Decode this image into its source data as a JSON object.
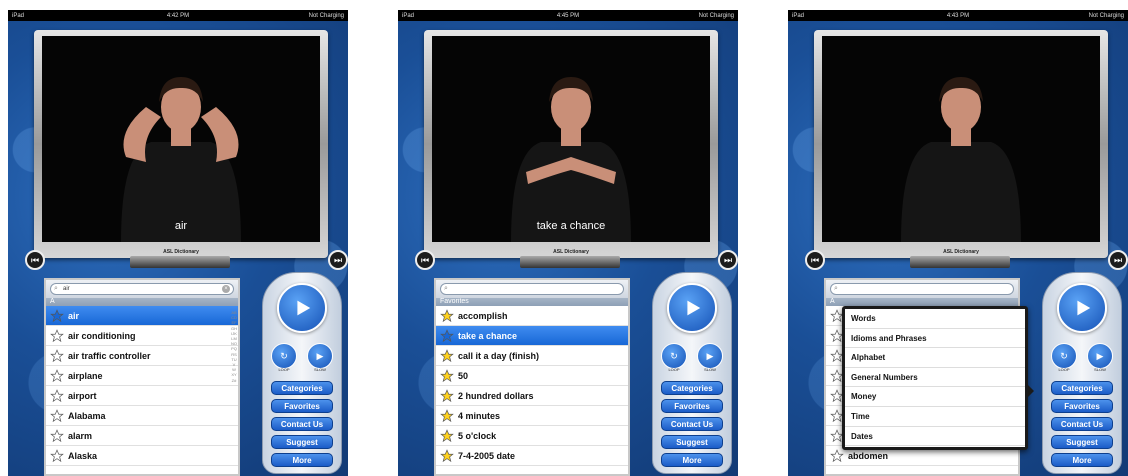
{
  "screens": [
    {
      "status": {
        "left": "iPad",
        "time": "4:42 PM",
        "right": "Not Charging"
      },
      "caption": "air",
      "brand": "ASL Dictionary",
      "search": {
        "value": "air",
        "has_clear": true
      },
      "section_header": "A",
      "items": [
        {
          "label": "air",
          "selected": true
        },
        {
          "label": "air conditioning",
          "selected": false
        },
        {
          "label": "air traffic controller",
          "selected": false
        },
        {
          "label": "airplane",
          "selected": false
        },
        {
          "label": "airport",
          "selected": false
        },
        {
          "label": "Alabama",
          "selected": false
        },
        {
          "label": "alarm",
          "selected": false
        },
        {
          "label": "Alaska",
          "selected": false
        }
      ],
      "star_color": "#ffffff"
    },
    {
      "status": {
        "left": "iPad",
        "time": "4:45 PM",
        "right": "Not Charging"
      },
      "caption": "take a chance",
      "brand": "ASL Dictionary",
      "search": {
        "value": "",
        "has_clear": false
      },
      "section_header": "Favorites",
      "items": [
        {
          "label": "accomplish",
          "selected": false
        },
        {
          "label": "take a chance",
          "selected": true
        },
        {
          "label": "call it a day (finish)",
          "selected": false
        },
        {
          "label": "50",
          "selected": false
        },
        {
          "label": "2 hundred dollars",
          "selected": false
        },
        {
          "label": "4 minutes",
          "selected": false
        },
        {
          "label": "5 o'clock",
          "selected": false
        },
        {
          "label": "7-4-2005 date",
          "selected": false
        }
      ],
      "star_color": "#ffd21f"
    },
    {
      "status": {
        "left": "iPad",
        "time": "4:43 PM",
        "right": "Not Charging"
      },
      "caption": "",
      "brand": "ASL Dictionary",
      "search": {
        "value": "",
        "has_clear": false
      },
      "section_header": "A",
      "items": [
        {
          "label": "",
          "selected": false
        },
        {
          "label": "",
          "selected": false
        },
        {
          "label": "",
          "selected": false
        },
        {
          "label": "",
          "selected": false
        },
        {
          "label": "",
          "selected": false
        },
        {
          "label": "",
          "selected": false
        },
        {
          "label": "",
          "selected": false
        },
        {
          "label": "abdomen",
          "selected": false
        }
      ],
      "star_color": "#ffffff",
      "popover": [
        "Words",
        "Idioms and Phrases",
        "Alphabet",
        "General Numbers",
        "Money",
        "Time",
        "Dates"
      ]
    }
  ],
  "remote": {
    "loop_label": "LOOP",
    "slow_label": "SLOW",
    "buttons": [
      "Categories",
      "Favorites",
      "Contact Us",
      "Suggest",
      "More"
    ]
  },
  "index_letters": "ABCDEFGHIJKLMNOPQRSTUVWXYZ#",
  "colors": {
    "background": "#1a4f97",
    "selection": "#1867d6",
    "remote_button": "#1b5cc7"
  }
}
